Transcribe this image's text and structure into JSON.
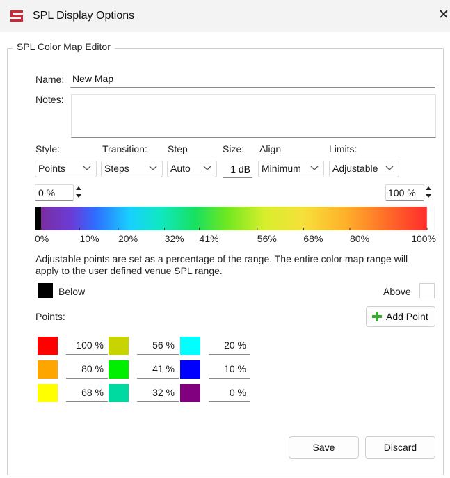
{
  "window": {
    "title": "SPL Display Options",
    "close_glyph": "✕"
  },
  "group_title": "SPL Color Map Editor",
  "name": {
    "label": "Name:",
    "value": "New Map"
  },
  "notes": {
    "label": "Notes:",
    "value": ""
  },
  "settings": {
    "style": {
      "label": "Style:",
      "value": "Points"
    },
    "transition": {
      "label": "Transition:",
      "value": "Steps"
    },
    "step": {
      "label": "Step",
      "value": "Auto"
    },
    "size": {
      "label": "Size:",
      "value": "1 dB"
    },
    "align": {
      "label": "Align",
      "value": "Minimum"
    },
    "limits": {
      "label": "Limits:",
      "value": "Adjustable"
    }
  },
  "range": {
    "min": "0 %",
    "max": "100 %"
  },
  "gradient_ticks": [
    {
      "label": "0%",
      "value": 0
    },
    {
      "label": "10%",
      "value": 10
    },
    {
      "label": "20%",
      "value": 20
    },
    {
      "label": "32%",
      "value": 32
    },
    {
      "label": "41%",
      "value": 41
    },
    {
      "label": "56%",
      "value": 56
    },
    {
      "label": "68%",
      "value": 68
    },
    {
      "label": "80%",
      "value": 80
    },
    {
      "label": "100%",
      "value": 100
    }
  ],
  "description": "Adjustable points are set as a percentage of the range. The entire color map range will apply to the user defined venue SPL range.",
  "below": {
    "label": "Below",
    "color": "#000000"
  },
  "above": {
    "label": "Above",
    "color": "#ffffff"
  },
  "points_label": "Points:",
  "add_point_label": "Add Point",
  "points": [
    {
      "color": "#ff0000",
      "value": "100 %"
    },
    {
      "color": "#ffa500",
      "value": "80 %"
    },
    {
      "color": "#ffff00",
      "value": "68 %"
    },
    {
      "color": "#c8d400",
      "value": "56 %"
    },
    {
      "color": "#00ee00",
      "value": "41 %"
    },
    {
      "color": "#00d9a0",
      "value": "32 %"
    },
    {
      "color": "#00ffff",
      "value": "20 %"
    },
    {
      "color": "#0000ff",
      "value": "10 %"
    },
    {
      "color": "#800080",
      "value": "0 %"
    }
  ],
  "footer": {
    "save": "Save",
    "discard": "Discard"
  }
}
